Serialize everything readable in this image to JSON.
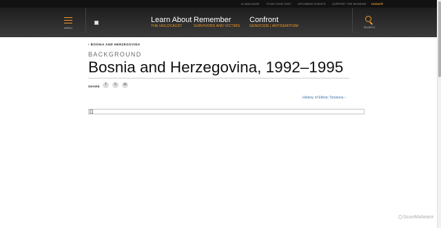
{
  "utility_bar": {
    "language": "▾ LANGUAGE",
    "plan_visit": "PLAN YOUR VISIT",
    "upcoming_events": "UPCOMING EVENTS",
    "support": "SUPPORT THE MUSEUM",
    "donate": "DONATE"
  },
  "header": {
    "menu_label": "MENU",
    "search_label": "SEARCH",
    "nav": [
      {
        "title": "Learn About",
        "subtitle": "THE HOLOCAUST"
      },
      {
        "title": "Remember",
        "subtitle": "SURVIVORS AND VICTIMS"
      },
      {
        "title": "Confront",
        "subtitle": "GENOCIDE | ANTISEMITISM"
      }
    ]
  },
  "main": {
    "breadcrumb": "‹ BOSNIA AND HERZEGOVINA",
    "eyebrow": "BACKGROUND",
    "title": "Bosnia and Herzegovina, 1992–1995",
    "share_label": "SHARE",
    "share_icons": {
      "facebook": "f",
      "x": "𝕏",
      "email": "✉"
    },
    "related_link": "History of Ethnic Tensions ›"
  },
  "watermark": "ScanMalware",
  "colors": {
    "header_bg": "#2e2e2e",
    "accent": "#f39a25",
    "link": "#3b6ea8",
    "donate": "#f0a12a"
  },
  "icons": [
    "hamburger-menu-icon",
    "search-icon",
    "facebook-icon",
    "x-icon",
    "email-icon",
    "broken-image-icon"
  ]
}
